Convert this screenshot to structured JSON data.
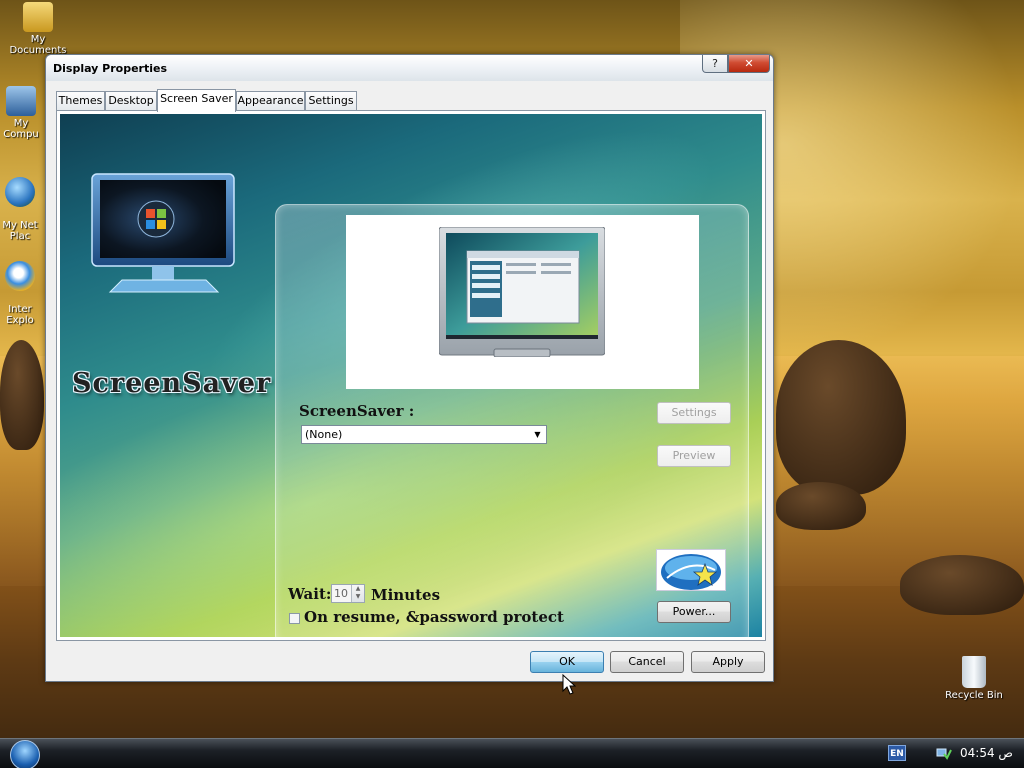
{
  "desktop": {
    "icons": [
      {
        "label": "My Documents"
      },
      {
        "label": "My Compu"
      },
      {
        "label": "My Net\nPlac"
      },
      {
        "label": "Inter\nExplo"
      },
      {
        "label": "Recycle Bin"
      }
    ]
  },
  "dialog": {
    "title": "Display Properties",
    "help_label": "?",
    "close_label": "✕",
    "tabs": [
      {
        "label": "Themes"
      },
      {
        "label": "Desktop"
      },
      {
        "label": "Screen Saver"
      },
      {
        "label": "Appearance"
      },
      {
        "label": "Settings"
      }
    ],
    "active_tab": "Screen Saver",
    "brand_text": "ScreenSaver",
    "screensaver_label": "ScreenSaver :",
    "screensaver_value": "(None)",
    "settings_button": "Settings",
    "preview_button": "Preview",
    "wait_label": "Wait:",
    "wait_value": "10",
    "minutes_label": "Minutes",
    "resume_label": "On resume, &password protect",
    "power_button": "Power...",
    "ok_button": "OK",
    "cancel_button": "Cancel",
    "apply_button": "Apply"
  },
  "taskbar": {
    "language": "EN",
    "clock": "04:54 ص"
  }
}
